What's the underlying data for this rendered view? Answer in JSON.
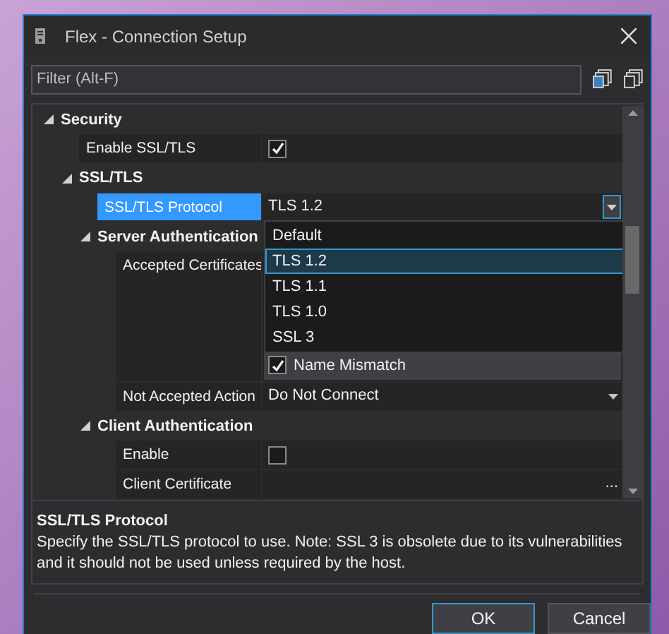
{
  "window": {
    "title": "Flex - Connection Setup"
  },
  "filter": {
    "placeholder": "Filter (Alt-F)"
  },
  "grid": {
    "items": [
      {
        "kind": "category",
        "label": "Security",
        "expanded": true,
        "children": [
          {
            "kind": "checkbox",
            "label": "Enable SSL/TLS",
            "checked": true,
            "selected": false
          },
          {
            "kind": "category",
            "label": "SSL/TLS",
            "expanded": true,
            "children": [
              {
                "kind": "dropdown",
                "label": "SSL/TLS Protocol",
                "value": "TLS 1.2",
                "selected": true,
                "open": true
              },
              {
                "kind": "category",
                "label": "Server Authentication",
                "expanded": true,
                "children": [
                  {
                    "kind": "checklist",
                    "label": "Accepted Certificates",
                    "selected": false,
                    "options": [
                      {
                        "label": "Name Mismatch",
                        "checked": true
                      }
                    ]
                  },
                  {
                    "kind": "dropdown",
                    "label": "Not Accepted Action",
                    "value": "Do Not Connect",
                    "selected": false,
                    "open": false
                  }
                ]
              },
              {
                "kind": "category",
                "label": "Client Authentication",
                "expanded": true,
                "children": [
                  {
                    "kind": "checkbox",
                    "label": "Enable",
                    "checked": false,
                    "selected": false
                  },
                  {
                    "kind": "browse",
                    "label": "Client Certificate",
                    "button_label": "...",
                    "selected": false
                  }
                ]
              }
            ]
          }
        ]
      }
    ]
  },
  "dropdown_options": [
    {
      "label": "Default",
      "selected": false
    },
    {
      "label": "TLS 1.2",
      "selected": true
    },
    {
      "label": "TLS 1.1",
      "selected": false
    },
    {
      "label": "TLS 1.0",
      "selected": false
    },
    {
      "label": "SSL 3",
      "selected": false
    }
  ],
  "description": {
    "title": "SSL/TLS Protocol",
    "text": "Specify the SSL/TLS protocol to use. Note: SSL 3 is obsolete due to its vulnerabilities and it should not be used unless required by the host."
  },
  "buttons": [
    {
      "label": "OK",
      "default": true
    },
    {
      "label": "Cancel",
      "default": false
    }
  ]
}
